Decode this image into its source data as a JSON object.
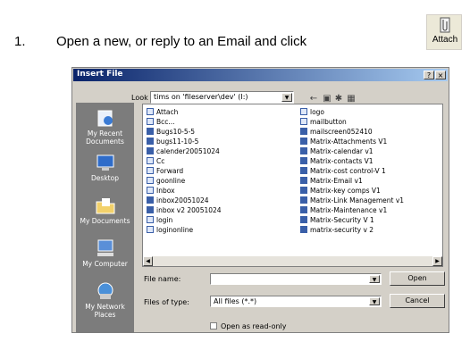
{
  "instruction": {
    "number": "1.",
    "text": "Open a new, or reply to an Email and click",
    "attach_label": "Attach"
  },
  "dialog": {
    "title": "Insert File",
    "help_btn": "?",
    "close_btn": "×",
    "look_in_label": "Look in:",
    "look_in_value": "tims on 'fileserver\\dev' (I:)",
    "places": [
      {
        "label": "My Recent Documents",
        "icon": "recent-documents-icon"
      },
      {
        "label": "Desktop",
        "icon": "desktop-icon"
      },
      {
        "label": "My Documents",
        "icon": "my-documents-icon"
      },
      {
        "label": "My Computer",
        "icon": "my-computer-icon"
      },
      {
        "label": "My Network Places",
        "icon": "network-places-icon"
      }
    ],
    "files_col1": [
      "Attach",
      "Bcc...",
      "Bugs10-5-5",
      "bugs11-10-5",
      "calender20051024",
      "Cc",
      "Forward",
      "goonline",
      "Inbox",
      "inbox20051024",
      "inbox v2 20051024",
      "login",
      "loginonline"
    ],
    "files_col2": [
      "logo",
      "mailbutton",
      "mailscreen052410",
      "Matrix-Attachments V1",
      "Matrix-calendar v1",
      "Matrix-contacts V1",
      "Matrix-cost control-V 1",
      "Matrix-Email v1",
      "Matrix-key comps V1",
      "Matrix-Link Management v1",
      "Matrix-Maintenance v1",
      "Matrix-Security V 1",
      "matrix-security v 2"
    ],
    "file_name_label": "File name:",
    "file_name_value": "",
    "file_type_label": "Files of type:",
    "file_type_value": "All files (*.*)",
    "read_only_label": "Open as read-only",
    "open_label": "Open",
    "cancel_label": "Cancel"
  }
}
